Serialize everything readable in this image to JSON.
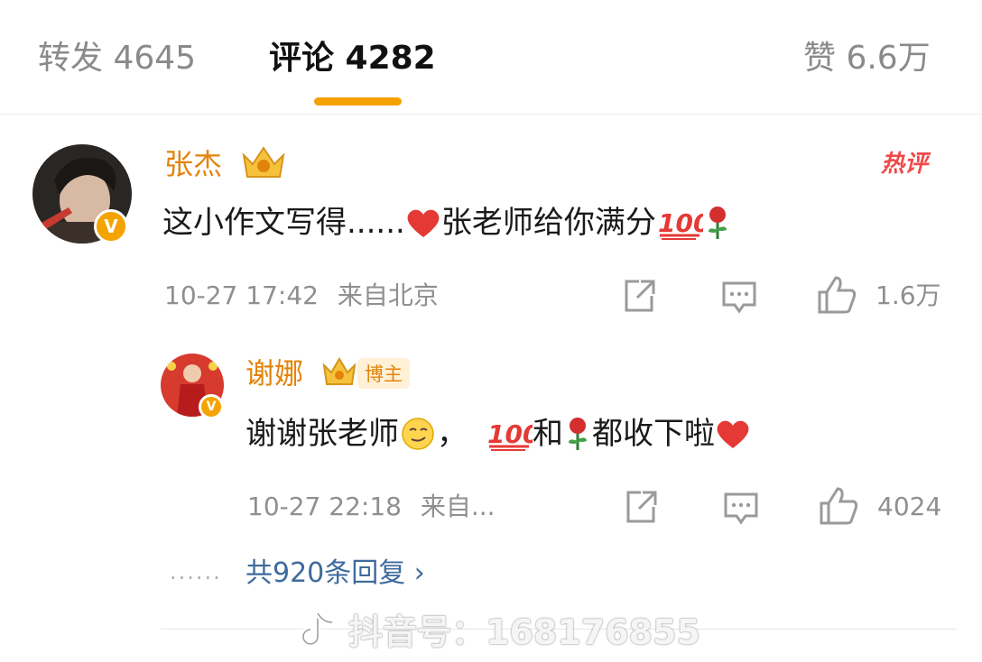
{
  "tabs": {
    "repost": "转发 4645",
    "comment": "评论 4282",
    "like": "赞 6.6万"
  },
  "comment": {
    "username": "张杰",
    "hot_label": "热评",
    "text_part1": "这小作文写得......",
    "text_part2": "张老师给你满分",
    "time": "10-27 17:42",
    "location": "来自北京",
    "like_count": "1.6万"
  },
  "reply": {
    "username": "谢娜",
    "tag": "博主",
    "text_part1": "谢谢张老师",
    "text_part2": "，",
    "text_part3": "和",
    "text_part4": "都收下啦",
    "time": "10-27 22:18",
    "location": "来自...",
    "like_count": "4024"
  },
  "more_replies": {
    "dots": "......",
    "label": "共920条回复 ›"
  },
  "watermark": "抖音号：168176855",
  "colors": {
    "accent": "#f4a200",
    "username": "#e2830a",
    "link": "#3d6a9c",
    "hot": "#f04a4a"
  }
}
